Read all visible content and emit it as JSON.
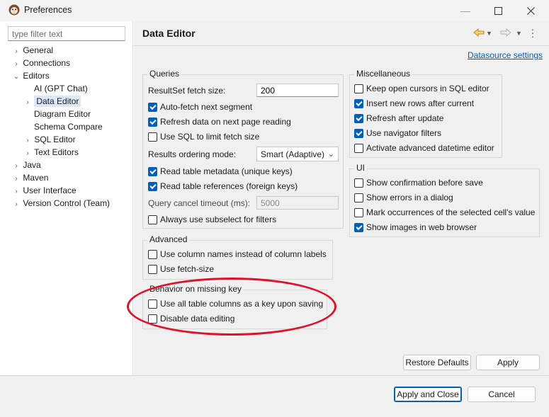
{
  "window": {
    "title": "Preferences"
  },
  "filter": {
    "placeholder": "type filter text"
  },
  "tree": {
    "general": "General",
    "connections": "Connections",
    "editors": "Editors",
    "gpt_chat": "AI (GPT Chat)",
    "data_editor": "Data Editor",
    "diagram_editor": "Diagram Editor",
    "schema_compare": "Schema Compare",
    "sql_editor": "SQL Editor",
    "text_editors": "Text Editors",
    "java": "Java",
    "maven": "Maven",
    "user_interface": "User Interface",
    "version_control": "Version Control (Team)"
  },
  "page": {
    "title": "Data Editor",
    "datasource_link": "Datasource settings"
  },
  "queries": {
    "title": "Queries",
    "fetch_size_label": "ResultSet fetch size:",
    "fetch_size_value": "200",
    "auto_fetch": "Auto-fetch next segment",
    "refresh_next_page": "Refresh data on next page reading",
    "use_sql_limit": "Use SQL to limit fetch size",
    "ordering_label": "Results ordering mode:",
    "ordering_value": "Smart (Adaptive)",
    "read_metadata": "Read table metadata (unique keys)",
    "read_references": "Read table references (foreign keys)",
    "cancel_timeout_label": "Query cancel timeout (ms):",
    "cancel_timeout_value": "5000",
    "always_subselect": "Always use subselect for filters"
  },
  "advanced": {
    "title": "Advanced",
    "column_names": "Use column names instead of column labels",
    "fetch_size": "Use fetch-size"
  },
  "missing_key": {
    "title": "Behavior on missing key",
    "all_columns": "Use all table columns as a key upon saving",
    "disable_editing": "Disable data editing"
  },
  "misc": {
    "title": "Miscellaneous",
    "keep_cursors": "Keep open cursors in SQL editor",
    "insert_rows": "Insert new rows after current",
    "refresh_after_update": "Refresh after update",
    "navigator_filters": "Use navigator filters",
    "datetime_editor": "Activate advanced datetime editor"
  },
  "ui": {
    "title": "UI",
    "show_confirmation": "Show confirmation before save",
    "show_errors": "Show errors in a dialog",
    "mark_occurrences": "Mark occurrences of the selected cell's value",
    "show_images": "Show images in web browser"
  },
  "buttons": {
    "restore_defaults": "Restore Defaults",
    "apply": "Apply",
    "apply_close": "Apply and Close",
    "cancel": "Cancel"
  },
  "colors": {
    "accent": "#005fb8",
    "link": "#0b5cad",
    "annotation": "#e0112b"
  }
}
